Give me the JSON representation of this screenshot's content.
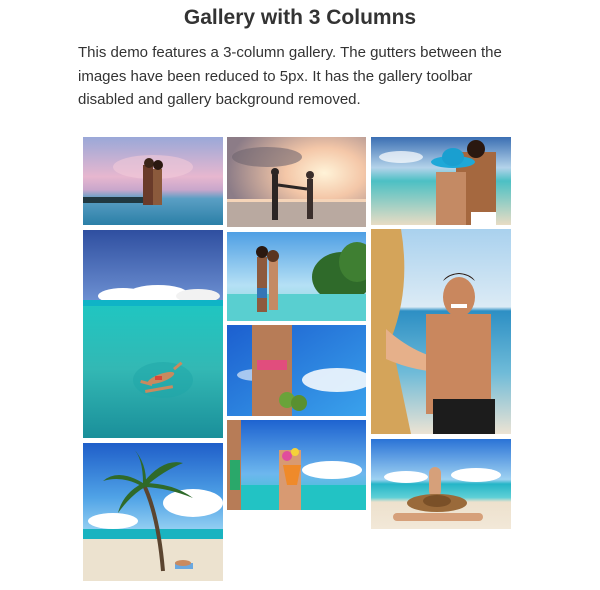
{
  "page": {
    "title": "Gallery with 3 Columns",
    "description": "This demo features a 3-column gallery. The gutters between the images have been reduced to 5px. It has the gallery toolbar disabled and gallery background removed."
  },
  "gallery": {
    "columns": 3,
    "gutter": "5px",
    "items": [
      {
        "id": "couple-sunset-sky",
        "desc": "couple embracing in the sea under pink sky"
      },
      {
        "id": "couple-holding-hands-sunset",
        "desc": "couple holding hands at sunset beach"
      },
      {
        "id": "couple-blue-hat",
        "desc": "couple hugging, woman in blue sun hat"
      },
      {
        "id": "swimmer-turquoise-water",
        "desc": "person floating in turquoise water"
      },
      {
        "id": "couple-kissing-beach",
        "desc": "couple kissing on tropical beach"
      },
      {
        "id": "woman-coconuts",
        "desc": "woman in bikini holding coconuts"
      },
      {
        "id": "man-pulling-hand",
        "desc": "smiling man pulling woman's hand"
      },
      {
        "id": "palm-tree-beach",
        "desc": "palm tree over beach with person lying"
      },
      {
        "id": "tropical-drink",
        "desc": "hand holding tropical cocktail"
      },
      {
        "id": "woman-straw-hat",
        "desc": "woman with straw hat lying on sand"
      }
    ]
  },
  "colors": {
    "text": "#333333",
    "sky": "#2f7fd6",
    "sea": "#2ec6c6",
    "sand": "#eadcc2"
  }
}
